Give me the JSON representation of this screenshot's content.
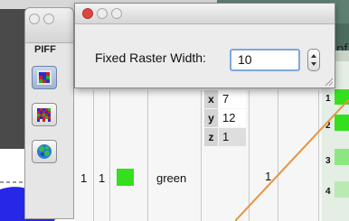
{
  "palette": {
    "title": "PIFF",
    "tools": [
      {
        "icon": "grid-raster-blue-icon"
      },
      {
        "icon": "grid-raster-red-icon"
      },
      {
        "icon": "globe-pattern-icon"
      }
    ]
  },
  "dialog": {
    "field_label": "Fixed Raster Width:",
    "field_value": "10"
  },
  "background_window": {
    "partial_title": "pf",
    "xyz": [
      {
        "axis": "x",
        "value": "7"
      },
      {
        "axis": "y",
        "value": "12"
      },
      {
        "axis": "z",
        "value": "1"
      }
    ],
    "row": {
      "col1": "1",
      "col2": "1",
      "name": "green",
      "count": "1"
    },
    "row_numbers": [
      "1",
      "2",
      "3",
      "4"
    ]
  },
  "colors": {
    "swatch_green": "#34e01d",
    "focus_ring": "#7ea7dc",
    "close_button": "#e0443e",
    "line_orange": "#e89440"
  }
}
